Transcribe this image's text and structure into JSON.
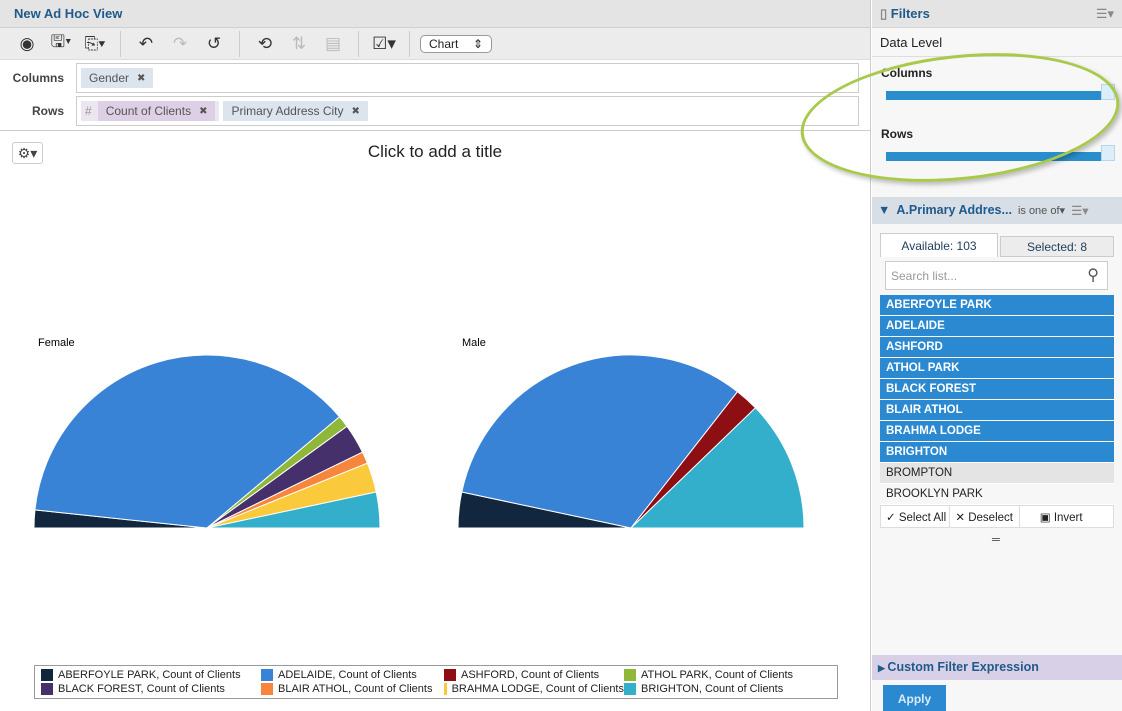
{
  "title": "New Ad Hoc View",
  "toolbar": {
    "view_type": "Chart",
    "icons": [
      "eye-icon",
      "save-icon",
      "export-icon",
      "undo-icon",
      "redo-icon",
      "undo-all-icon",
      "pivot-icon",
      "sort-icon",
      "layout-icon",
      "options-icon"
    ]
  },
  "columns": {
    "label": "Columns",
    "fields": [
      "Gender"
    ]
  },
  "rows": {
    "label": "Rows",
    "measure_marker": "#",
    "measure": "Count of Clients",
    "fields": [
      "Primary Address City"
    ]
  },
  "chart_title": "Click to add a title",
  "chart_data": [
    {
      "type": "pie",
      "variant": "semi-circle",
      "title": "Female",
      "categories": [
        "ABERFOYLE PARK",
        "ADELAIDE",
        "ATHOL PARK",
        "BLACK FOREST",
        "BLAIR ATHOL",
        "BRAHMA LODGE",
        "BRIGHTON"
      ],
      "values": [
        6,
        134,
        4,
        10,
        4,
        10,
        12
      ]
    },
    {
      "type": "pie",
      "variant": "semi-circle",
      "title": "Male",
      "categories": [
        "ABERFOYLE PARK",
        "ADELAIDE",
        "ASHFORD",
        "BRIGHTON"
      ],
      "values": [
        12,
        116,
        8,
        44
      ]
    }
  ],
  "legend": [
    {
      "label": "ABERFOYLE PARK, Count of Clients",
      "color": "#12263d"
    },
    {
      "label": "ADELAIDE, Count of Clients",
      "color": "#3983d6"
    },
    {
      "label": "ASHFORD, Count of Clients",
      "color": "#8d0f14"
    },
    {
      "label": "ATHOL PARK, Count of Clients",
      "color": "#8fb83a"
    },
    {
      "label": "BLACK FOREST, Count of Clients",
      "color": "#46306b"
    },
    {
      "label": "BLAIR ATHOL, Count of Clients",
      "color": "#f6863c"
    },
    {
      "label": "BRAHMA LODGE, Count of Clients",
      "color": "#fbc93c"
    },
    {
      "label": "BRIGHTON, Count of Clients",
      "color": "#33aecb"
    }
  ],
  "filters": {
    "title": "Filters",
    "data_level": "Data Level",
    "columns_label": "Columns",
    "columns_level_pct": 100,
    "rows_label": "Rows",
    "rows_level_pct": 100,
    "filter_name": "A.Primary Addres...",
    "operator": "is one of",
    "available_tab": "Available: 103",
    "selected_tab": "Selected: 8",
    "search_placeholder": "Search list...",
    "items": [
      {
        "label": "ABERFOYLE PARK",
        "selected": true
      },
      {
        "label": "ADELAIDE",
        "selected": true
      },
      {
        "label": "ASHFORD",
        "selected": true
      },
      {
        "label": "ATHOL PARK",
        "selected": true
      },
      {
        "label": "BLACK FOREST",
        "selected": true
      },
      {
        "label": "BLAIR ATHOL",
        "selected": true
      },
      {
        "label": "BRAHMA LODGE",
        "selected": true
      },
      {
        "label": "BRIGHTON",
        "selected": true
      },
      {
        "label": "BROMPTON",
        "selected": false
      },
      {
        "label": "BROOKLYN PARK",
        "selected": false
      }
    ],
    "select_all": "Select All",
    "deselect": "Deselect",
    "invert": "Invert",
    "custom_expression": "Custom Filter Expression",
    "apply": "Apply"
  }
}
